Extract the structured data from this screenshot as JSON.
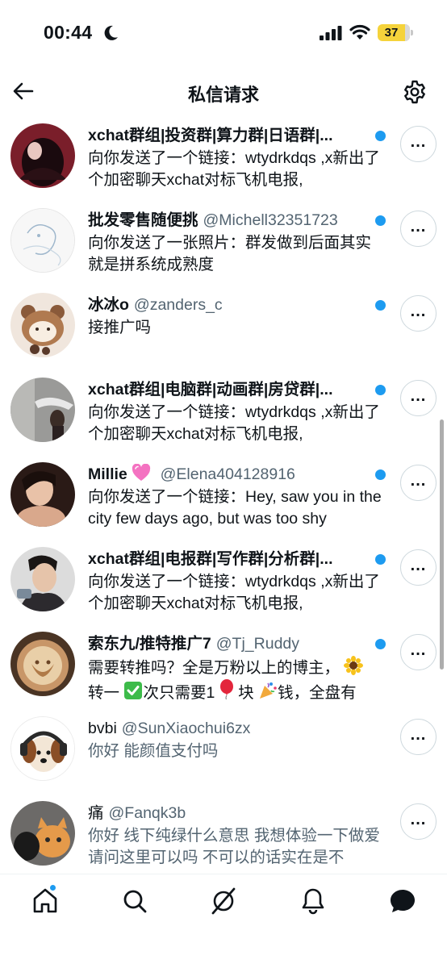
{
  "status_bar": {
    "time": "00:44",
    "battery": "37"
  },
  "header": {
    "title": "私信请求"
  },
  "rows": [
    {
      "name": "xchat群组|投资群|算力群|日语群|...",
      "handle": "",
      "msg": "向你发送了一个链接：wtydrkdqs ,x新出了个加密聊天xchat对标飞机电报,",
      "unread": true
    },
    {
      "name": "批发零售随便挑",
      "handle": "@Michell32351723",
      "msg": "向你发送了一张照片：群发做到后面其实就是拼系统成熟度",
      "unread": true
    },
    {
      "name": "冰冰o",
      "handle": "@zanders_c",
      "msg": "接推广吗",
      "unread": true
    },
    {
      "name": "xchat群组|电脑群|动画群|房贷群|...",
      "handle": "",
      "msg": "向你发送了一个链接：wtydrkdqs ,x新出了个加密聊天xchat对标飞机电报,",
      "unread": true
    },
    {
      "name": "Millie",
      "handle": "@Elena404128916",
      "msg": "向你发送了一个链接：Hey, saw you in the city few days ago, but was too shy",
      "unread": true
    },
    {
      "name": "xchat群组|电报群|写作群|分析群|...",
      "handle": "",
      "msg": "向你发送了一个链接：wtydrkdqs ,x新出了个加密聊天xchat对标飞机电报,",
      "unread": true
    },
    {
      "name": "索东九/推特推广7",
      "handle": "@Tj_Ruddy",
      "msg_a": "需要转推吗？全是万粉以上的博主，",
      "msg_b": "转一",
      "msg_c": "次只需要1",
      "msg_d": "块",
      "msg_e": "钱，全盘有",
      "unread": true
    },
    {
      "name": "bvbi",
      "handle": "@SunXiaochui6zx",
      "msg": "你好 能颜值支付吗",
      "unread": false
    },
    {
      "name": "痛",
      "handle": "@Fanqk3b",
      "msg": "你好 线下纯绿什么意思 我想体验一下做爱 请问这里可以吗 不可以的话实在是不",
      "unread": false
    }
  ],
  "icons": {
    "back": "arrow-left-icon",
    "settings": "gear-icon",
    "more": "more-icon",
    "nav": [
      "home-icon",
      "search-icon",
      "grok-icon",
      "bell-icon",
      "messages-icon"
    ]
  },
  "colors": {
    "accent": "#1d9bf0",
    "text": "#0f1419",
    "secondary": "#536471",
    "battery": "#f5d33b"
  }
}
